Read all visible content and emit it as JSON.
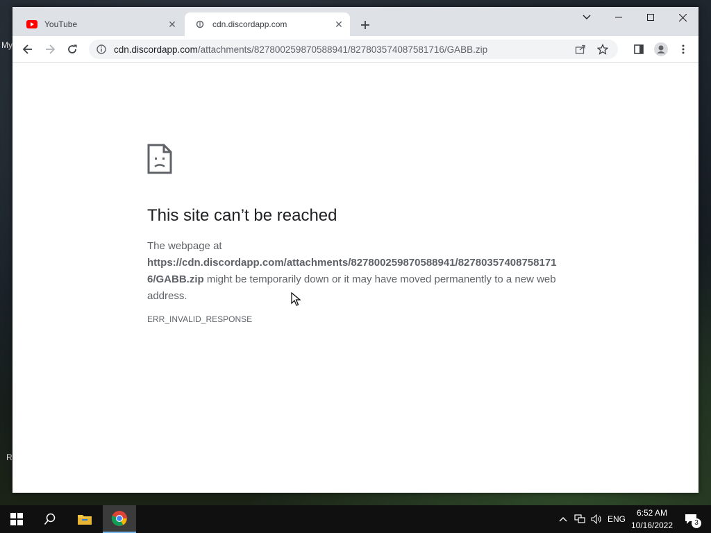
{
  "desktop": {
    "fragments": [
      "My",
      "R"
    ]
  },
  "browser": {
    "tabs": [
      {
        "label": "YouTube",
        "favicon": "youtube-icon",
        "active": false
      },
      {
        "label": "cdn.discordapp.com",
        "favicon": "globe-icon",
        "active": true
      }
    ],
    "new_tab_icon": "plus-icon",
    "window_controls": [
      "chevron-down-icon",
      "minimize-icon",
      "maximize-icon",
      "close-icon"
    ],
    "address_bar": {
      "domain": "cdn.discordapp.com",
      "path": "/attachments/827800259870588941/827803574087581716/GABB.zip"
    }
  },
  "error_page": {
    "title": "This site can’t be reached",
    "body_prefix": "The webpage at",
    "url": "https://cdn.discordapp.com/attachments/827800259870588941/827803574087581716/GABB.zip",
    "body_suffix": "might be temporarily down or it may have moved permanently to a new web address.",
    "error_code": "ERR_INVALID_RESPONSE"
  },
  "taskbar": {
    "language": "ENG",
    "time": "6:52 AM",
    "date": "10/16/2022",
    "notification_count": "3"
  },
  "colors": {
    "accent": "#1a73e8",
    "youtube_red": "#ff0000",
    "tabstrip": "#dee1e6",
    "taskbar": "#101010"
  }
}
